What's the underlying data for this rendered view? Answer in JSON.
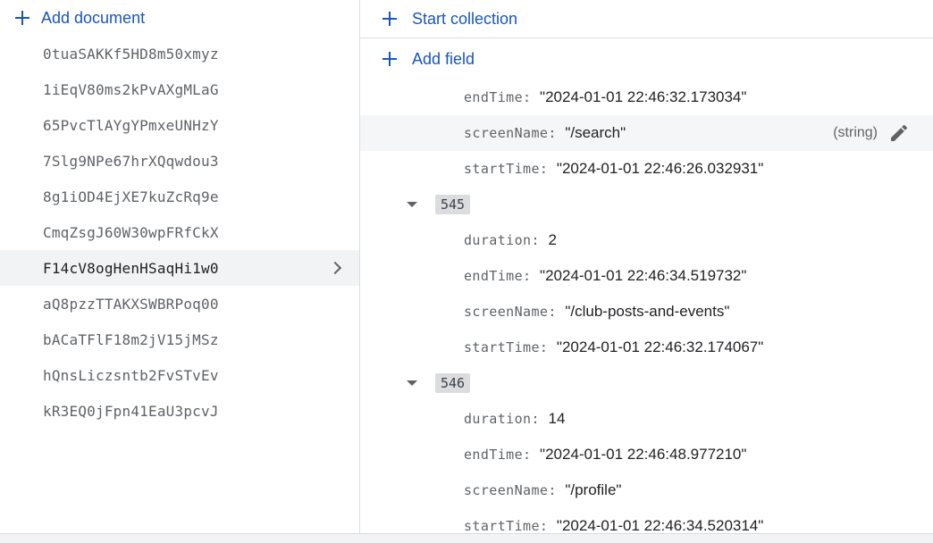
{
  "left_panel": {
    "add_document_label": "Add document",
    "documents": [
      "0tuaSAKKf5HD8m50xmyz",
      "1iEqV80ms2kPvAXgMLaG",
      "65PvcTlAYgYPmxeUNHzY",
      "7Slg9NPe67hrXQqwdou3",
      "8g1iOD4EjXE7kuZcRq9e",
      "CmqZsgJ60W30wpFRfCkX",
      "F14cV8ogHenHSaqHi1w0",
      "aQ8pzzTTAKXSWBRPoq00",
      "bACaTFlF18m2jV15jMSz",
      "hQnsLiczsntb2FvSTvEv",
      "kR3EQ0jFpn41EaU3pcvJ"
    ],
    "selected_index": 6
  },
  "right_panel": {
    "start_collection_label": "Start collection",
    "add_field_label": "Add field",
    "colon": ":",
    "rows": [
      {
        "kind": "field",
        "key": "endTime",
        "value": "\"2024-01-01 22:46:32.173034\""
      },
      {
        "kind": "field",
        "key": "screenName",
        "value": "\"/search\"",
        "highlight": true,
        "type_hint": "(string)"
      },
      {
        "kind": "field",
        "key": "startTime",
        "value": "\"2024-01-01 22:46:26.032931\""
      },
      {
        "kind": "group",
        "index": "545"
      },
      {
        "kind": "field",
        "key": "duration",
        "value": "2"
      },
      {
        "kind": "field",
        "key": "endTime",
        "value": "\"2024-01-01 22:46:34.519732\""
      },
      {
        "kind": "field",
        "key": "screenName",
        "value": "\"/club-posts-and-events\""
      },
      {
        "kind": "field",
        "key": "startTime",
        "value": "\"2024-01-01 22:46:32.174067\""
      },
      {
        "kind": "group",
        "index": "546"
      },
      {
        "kind": "field",
        "key": "duration",
        "value": "14"
      },
      {
        "kind": "field",
        "key": "endTime",
        "value": "\"2024-01-01 22:46:48.977210\""
      },
      {
        "kind": "field",
        "key": "screenName",
        "value": "\"/profile\""
      },
      {
        "kind": "field",
        "key": "startTime",
        "value": "\"2024-01-01 22:46:34.520314\""
      }
    ]
  },
  "colors": {
    "accent": "#1a56b8",
    "selected_bg": "#f1f3f4",
    "index_badge_bg": "#dadce0"
  }
}
